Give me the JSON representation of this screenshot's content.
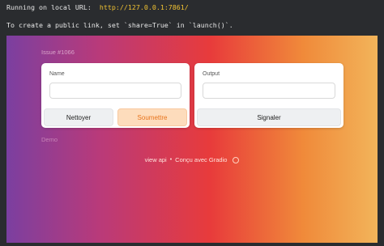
{
  "terminal": {
    "line1_prefix": "Running on local URL:  ",
    "line1_url": "http://127.0.0.1:7861/",
    "line2": "To create a public link, set `share=True` in `launch()`."
  },
  "app": {
    "title": "Issue #1066",
    "input": {
      "label": "Name",
      "value": ""
    },
    "output": {
      "label": "Output",
      "value": ""
    },
    "buttons": {
      "clear": "Nettoyer",
      "submit": "Soumettre",
      "flag": "Signaler"
    },
    "demo_label": "Demo",
    "footer": {
      "api_link": "view api",
      "separator": "•",
      "built_with": "Conçu avec Gradio"
    }
  },
  "colors": {
    "terminal_bg": "#2a2c2f",
    "url": "#f1c232",
    "submit_bg": "#fddcbc",
    "submit_text": "#e8741c"
  }
}
